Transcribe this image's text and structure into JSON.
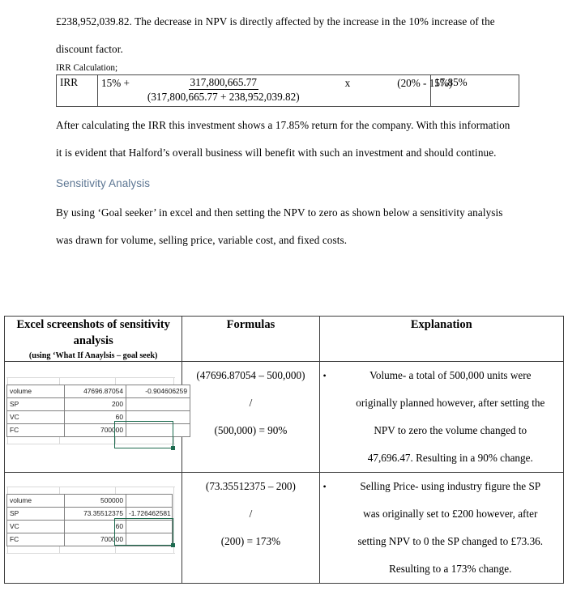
{
  "document": {
    "paragraphs": [
      "£238,952,039.82. The decrease in NPV is directly affected by the increase in the 10% increase of the discount factor.",
      "After calculating the IRR this investment shows a 17.85% return for the company. With this information it is evident that Halford’s overall business will benefit with such an investment and should continue."
    ],
    "heading": "Sensitivity Analysis",
    "paragraph_after_heading": "By using ‘Goal seeker’ in excel and then setting the NPV to zero as shown below a sensitivity analysis was drawn for volume, selling price, variable cost, and fixed costs."
  },
  "irr_table": {
    "caption": "IRR Calculation;",
    "label": "IRR",
    "lead": "15% +",
    "numerator": "317,800,665.77",
    "denominator": "(317,800,665.77 + 238,952,039.82)",
    "operator": "x",
    "bracket": "(20% - 15%)",
    "result": "17.85%"
  },
  "sensitivity_table": {
    "headers": {
      "excel": "Excel screenshots of sensitivity analysis",
      "excel_sub": "(using ‘What If Anaylsis – goal seek)",
      "formulas": "Formulas",
      "explanation": "Explanation"
    },
    "rows": [
      {
        "excel": {
          "cells": [
            {
              "label": "volume",
              "value": "47696.87054"
            },
            {
              "label": "SP",
              "value": "200"
            },
            {
              "label": "VC",
              "value": "60"
            },
            {
              "label": "FC",
              "value": "700000"
            }
          ],
          "output_value": "-0.904606259",
          "output_row": 1,
          "selection_start_row": 2,
          "selection_end_row": 3
        },
        "formula": {
          "line1": "(47696.87054 – 500,000)",
          "line2": "/",
          "line3": "(500,000) = 90%"
        },
        "explanation": "Volume- a total of 500,000 units were originally planned however, after setting the NPV to zero the volume changed to 47,696.47. Resulting in a 90% change.",
        "explanation_lines": [
          "Volume- a total of 500,000 units were",
          "originally planned however, after setting the",
          "NPV to zero the volume changed to",
          "47,696.47. Resulting in a 90% change."
        ]
      },
      {
        "excel": {
          "cells": [
            {
              "label": "volume",
              "value": "500000"
            },
            {
              "label": "SP",
              "value": "73.35512375"
            },
            {
              "label": "VC",
              "value": "60"
            },
            {
              "label": "FC",
              "value": "700000"
            }
          ],
          "output_value": "-1.726462581",
          "output_row": 2,
          "selection_start_row": 3,
          "selection_end_row": 4
        },
        "formula": {
          "line1": "(73.35512375 – 200)",
          "line2": "/",
          "line3": "(200) = 173%"
        },
        "explanation": "Selling Price- using industry figure the SP was originally set to £200 however, after setting NPV to 0 the SP changed to £73.36. Resulting to a 173% change.",
        "explanation_lines": [
          "Selling Price- using industry figure the SP",
          "was originally set to £200 however, after",
          "setting NPV to 0 the SP changed to £73.36.",
          "Resulting to a 173% change."
        ]
      }
    ],
    "bullet_glyph": "•"
  },
  "colors": {
    "heading": "#5b7592",
    "excel_selection": "#1d6b4f",
    "table_border": "#3c3c3c"
  }
}
